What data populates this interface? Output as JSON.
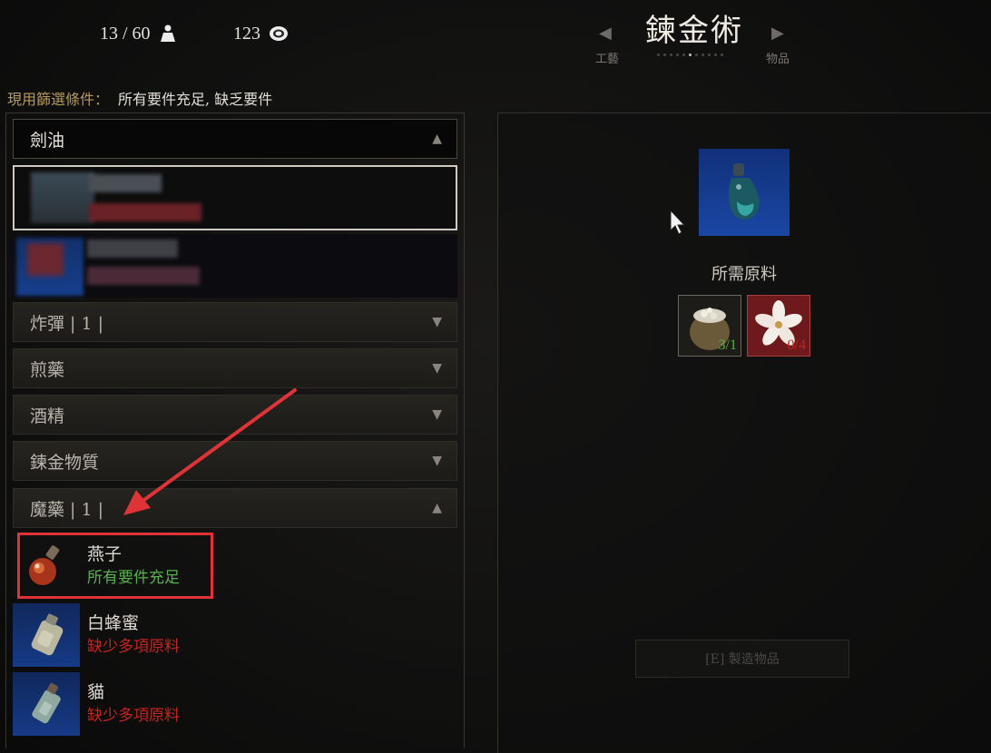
{
  "stats": {
    "weight": "13 / 60",
    "weight_icon": "weight-icon",
    "crowns": "123",
    "crowns_icon": "coin-icon"
  },
  "header": {
    "title": "鍊金術",
    "left_label": "工藝",
    "right_label": "物品",
    "page_count": 11,
    "page_active": 6
  },
  "filter": {
    "label": "現用篩選條件：",
    "value": "所有要件充足, 缺乏要件"
  },
  "categories": [
    {
      "label": "劍油",
      "expanded": true
    },
    {
      "label": "炸彈 | 1 |",
      "expanded": false
    },
    {
      "label": "煎藥",
      "expanded": false
    },
    {
      "label": "酒精",
      "expanded": false
    },
    {
      "label": "鍊金物質",
      "expanded": false
    },
    {
      "label": "魔藥 | 1 |",
      "expanded": true
    }
  ],
  "potions": [
    {
      "name": "燕子",
      "status": "所有要件充足",
      "status_color": "#58b04a",
      "icon": "swallow-potion-icon"
    },
    {
      "name": "白蜂蜜",
      "status": "缺少多項原料",
      "status_color": "#c8231d",
      "icon": "white-honey-potion-icon"
    },
    {
      "name": "貓",
      "status": "缺少多項原料",
      "status_color": "#c8231d",
      "icon": "cat-potion-icon"
    }
  ],
  "detail": {
    "icon": "blade-oil-icon",
    "required_label": "所需原料",
    "ingredients": [
      {
        "icon": "jar-ingredient-icon",
        "count": "3/1",
        "count_color": "#58b04a"
      },
      {
        "icon": "flower-ingredient-icon",
        "count": "0/4",
        "count_color": "#c8231d"
      }
    ],
    "craft_button": "[E] 製造物品"
  },
  "colors": {
    "accent_gold": "#b79a58",
    "highlight_red": "#e03338",
    "item_blue": "#163a86"
  }
}
